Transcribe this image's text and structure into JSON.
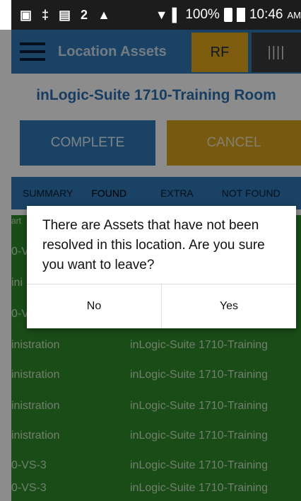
{
  "status_bar": {
    "notif_icons": [
      "▣",
      "‡",
      "▤",
      "2",
      "▲"
    ],
    "battery": "100%",
    "time": "10:46",
    "ampm": "AM"
  },
  "appbar": {
    "title": "Location Assets",
    "rf_label": "RF",
    "barcode_label": "||||"
  },
  "location_title": "inLogic-Suite 1710-Training Room",
  "buttons": {
    "complete": "COMPLETE",
    "cancel": "CANCEL"
  },
  "tabs": [
    "SUMMARY",
    "FOUND",
    "EXTRA",
    "NOT FOUND"
  ],
  "list": {
    "header_fragment": "art",
    "rows": [
      {
        "c1": "0-V",
        "c2": ""
      },
      {
        "c1": "ini",
        "c2": ""
      },
      {
        "c1": "0-V",
        "c2": ""
      },
      {
        "c1": "inistration",
        "c2": "inLogic-Suite 1710-Training"
      },
      {
        "c1": "inistration",
        "c2": "inLogic-Suite 1710-Training"
      },
      {
        "c1": "inistration",
        "c2": "inLogic-Suite 1710-Training"
      },
      {
        "c1": "inistration",
        "c2": "inLogic-Suite 1710-Training"
      },
      {
        "c1": "0-VS-3",
        "c2": "inLogic-Suite 1710-Training"
      },
      {
        "c1": "0-VS-3",
        "c2": "inLogic-Suite 1710-Training"
      }
    ]
  },
  "dialog": {
    "message": "There are Assets that have not been resolved in this location. Are you sure you want to leave?",
    "no_label": "No",
    "yes_label": "Yes"
  },
  "colors": {
    "primary": "#2f79b8",
    "accent": "#e4a81a",
    "list_bg": "#2e8a2a"
  }
}
